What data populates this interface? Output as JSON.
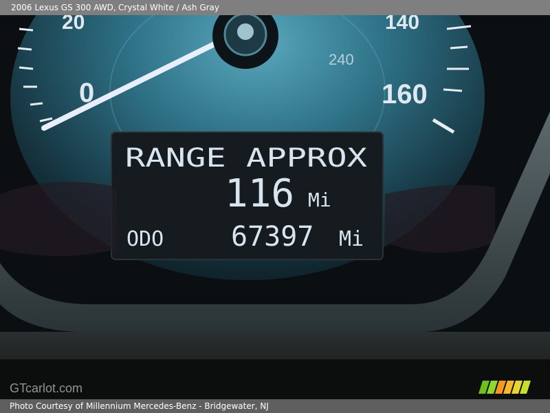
{
  "header": {
    "vehicle": "2006 Lexus GS 300 AWD,",
    "colors": "Crystal White / Ash Gray"
  },
  "gauge": {
    "speed_labels": [
      "20",
      "0",
      "140",
      "160",
      "240"
    ],
    "range_label": "RANGE APPROX",
    "range_value": "116",
    "range_unit": "Mi",
    "odo_label": "ODO",
    "odo_value": "67397",
    "odo_unit": "Mi"
  },
  "watermark": "GTcarlot.com",
  "footer": {
    "credit": "Photo Courtesy of Millennium Mercedes-Benz - Bridgewater, NJ"
  },
  "colors": {
    "topbar": "#7f7f7f",
    "footer": "#5f5f5f",
    "gauge_blue": "#3d8aa0",
    "lcd_bg": "#161b1f"
  }
}
